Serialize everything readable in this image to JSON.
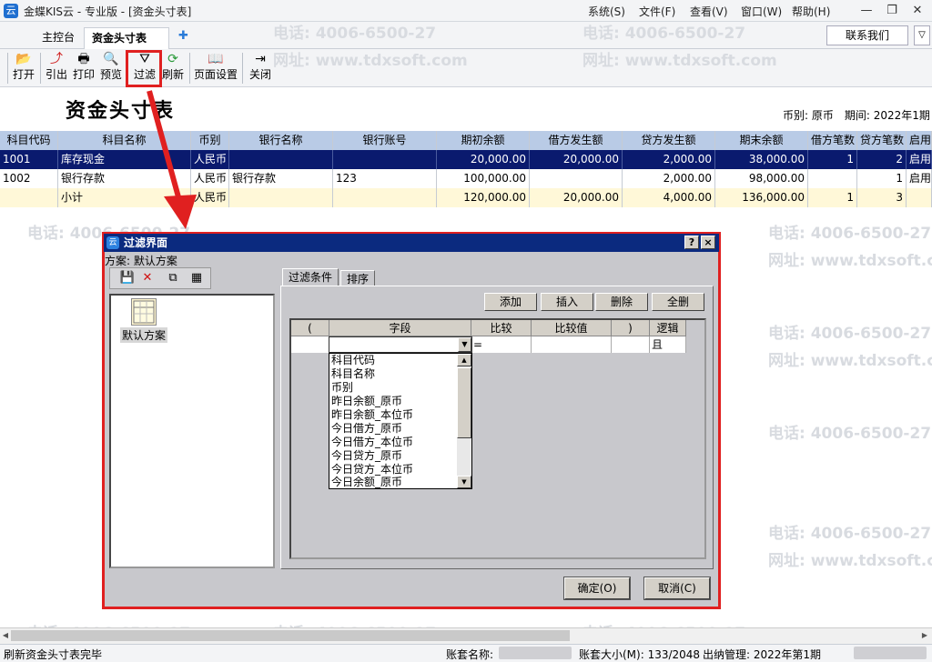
{
  "titlebar": {
    "logo": "云",
    "title": "金蝶KIS云 - 专业版 - [资金头寸表]",
    "menus": [
      "系统(S)",
      "文件(F)",
      "查看(V)",
      "窗口(W)",
      "帮助(H)"
    ],
    "win_min": "—",
    "win_max": "❐",
    "win_close": "✕"
  },
  "tabs": {
    "home": "主控台",
    "active": "资金头寸表",
    "close": "×",
    "new": "✚",
    "contact": "联系我们",
    "expand": "▽"
  },
  "toolbar": {
    "items": [
      {
        "label": "打开",
        "icon": "📂"
      },
      {
        "label": "引出",
        "icon": "⤴"
      },
      {
        "label": "打印",
        "icon": "🖶"
      },
      {
        "label": "预览",
        "icon": "🔍"
      },
      {
        "label": "过滤",
        "icon": "⛛"
      },
      {
        "label": "刷新",
        "icon": "⟳"
      },
      {
        "label": "页面设置",
        "icon": "📖"
      },
      {
        "label": "关闭",
        "icon": "⇥"
      }
    ]
  },
  "report": {
    "title": "资金头寸表",
    "currency_info": "币别: 原币　期间: 2022年1期"
  },
  "table": {
    "columns": [
      "科目代码",
      "科目名称",
      "币别",
      "银行名称",
      "银行账号",
      "期初余额",
      "借方发生额",
      "贷方发生额",
      "期末余额",
      "借方笔数",
      "贷方笔数",
      "启用"
    ],
    "rows": [
      [
        "1001",
        "库存现金",
        "人民币",
        "",
        "",
        "20,000.00",
        "20,000.00",
        "2,000.00",
        "38,000.00",
        "1",
        "2",
        "启用"
      ],
      [
        "1002",
        "银行存款",
        "人民币",
        "银行存款",
        "123",
        "100,000.00",
        "",
        "2,000.00",
        "98,000.00",
        "",
        "1",
        "启用"
      ],
      [
        "",
        "小计",
        "人民币",
        "",
        "",
        "120,000.00",
        "20,000.00",
        "4,000.00",
        "136,000.00",
        "1",
        "3",
        ""
      ]
    ]
  },
  "watermark": {
    "phone": "电话: 4006-6500-27",
    "site": "网址: www.tdxsoft.com"
  },
  "dialog": {
    "title": "过滤界面",
    "help": "?",
    "close": "×",
    "scheme_label": "方案: 默认方案",
    "scheme_tools": [
      "💾",
      "✕",
      "⧉",
      "▦"
    ],
    "scheme_item": "默认方案",
    "tabs": [
      "过滤条件",
      "排序"
    ],
    "actions": [
      "添加",
      "插入",
      "删除",
      "全删"
    ],
    "cond_headers": [
      "(",
      "字段",
      "比较",
      "比较值",
      ")",
      "逻辑"
    ],
    "cond_row": {
      "compare": "=",
      "logic": "且"
    },
    "field_options": [
      "科目代码",
      "科目名称",
      "币别",
      "昨日余额_原币",
      "昨日余额_本位币",
      "今日借方_原币",
      "今日借方_本位币",
      "今日贷方_原币",
      "今日贷方_本位币",
      "今日余额_原币"
    ],
    "ok": "确定(O)",
    "cancel": "取消(C)"
  },
  "status": {
    "message": "刷新资金头寸表完毕",
    "account_name_label": "账套名称:",
    "account_size": "账套大小(M): 133/2048",
    "period": "出纳管理: 2022年第1期"
  }
}
